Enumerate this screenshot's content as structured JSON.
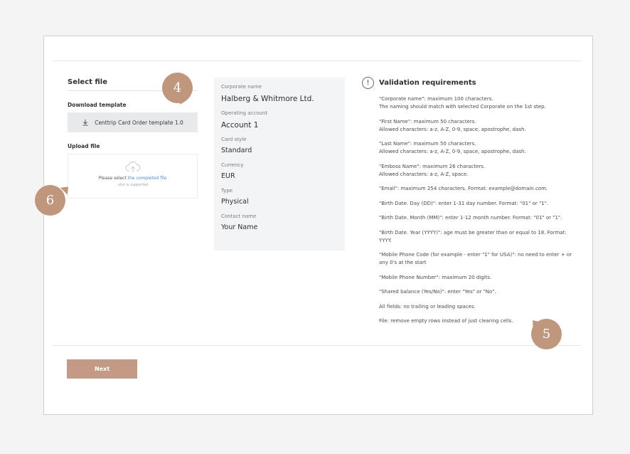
{
  "left": {
    "title": "Select file",
    "download_label": "Download template",
    "download_button": "Centtrip Card Order template 1.0",
    "upload_label": "Upload file",
    "dropzone_prefix": "Please select ",
    "dropzone_link": "the completed file",
    "dropzone_note": ".xlsx is supported"
  },
  "summary": {
    "fields": [
      {
        "label": "Corporate name",
        "value": "Halberg & Whitmore Ltd."
      },
      {
        "label": "Operating account",
        "value": "Account 1"
      },
      {
        "label": "Card style",
        "value": "Standard"
      },
      {
        "label": "Currency",
        "value": "EUR"
      },
      {
        "label": "Type",
        "value": "Physical"
      },
      {
        "label": "Contact name",
        "value": "Your Name"
      }
    ]
  },
  "validation": {
    "icon": "!",
    "title": "Validation requirements",
    "items": [
      [
        "\"Corporate name\": maximum 100 characters.",
        "The naming should match with selected Corporate on the 1st step."
      ],
      [
        "\"First Name\": maximum 50 characters.",
        "Allowed characters: a-z, A-Z, 0-9, space, apostrophe, dash."
      ],
      [
        "\"Last Name\": maximum 50 characters.",
        "Allowed characters: a-z, A-Z, 0-9, space, apostrophe, dash."
      ],
      [
        "\"Emboss Name\": maximum 26 characters.",
        "Allowed characters: a-z, A-Z, space."
      ],
      [
        "\"Email\": maximum 254 characters. Format: example@domain.com."
      ],
      [
        "\"Birth Date. Day (DD)\": enter 1-31 day number. Format: \"01\" or \"1\"."
      ],
      [
        "\"Birth Date. Month (MM)\": enter 1-12 month number. Format: \"01\" or \"1\"."
      ],
      [
        "\"Birth Date. Year (YYYY)\": age must be greater than or equal to 18. Format:",
        "YYYY."
      ],
      [
        "\"Mobile Phone Code (for example - enter \"1\" for USA)\": no need to enter + or",
        "any 0's at the start"
      ],
      [
        "\"Mobile Phone Number\": maximum 20 digits."
      ],
      [
        "\"Shared balance (Yes/No)\": enter \"Yes\" or \"No\"."
      ],
      [
        "All fields: no trailing or leading spaces."
      ],
      [
        "File: remove empty rows instead of just clearing cells."
      ]
    ]
  },
  "footer": {
    "next_label": "Next"
  },
  "markers": {
    "m4": "4",
    "m5": "5",
    "m6": "6"
  },
  "colors": {
    "accent": "#c29a85",
    "link": "#4f8fd6"
  }
}
